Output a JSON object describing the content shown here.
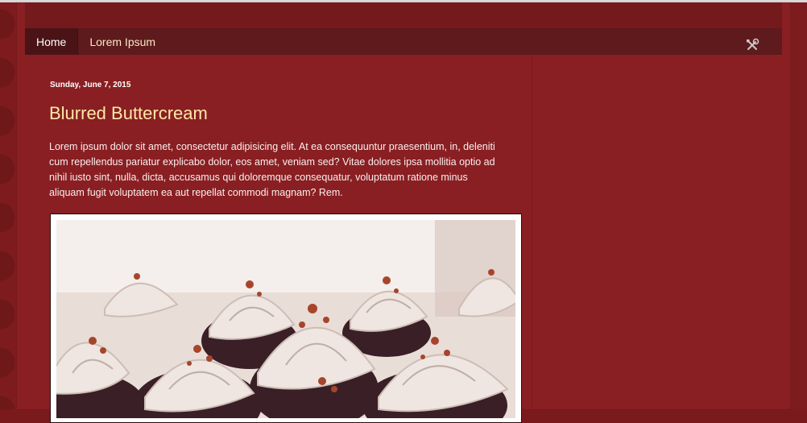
{
  "nav": {
    "tabs": [
      {
        "label": "Home"
      },
      {
        "label": "Lorem Ipsum"
      }
    ],
    "tools_icon": "tools-icon"
  },
  "post": {
    "date": "Sunday, June 7, 2015",
    "title": "Blurred Buttercream",
    "body": "Lorem ipsum dolor sit amet, consectetur adipisicing elit. At ea consequuntur praesentium, in, deleniti cum repellendus pariatur explicabo dolor, eos amet, veniam sed? Vitae dolores ipsa mollitia optio ad nihil iusto sint, nulla, dicta, accusamus qui doloremque consequatur, voluptatum ratione minus aliquam fugit voluptatem ea aut repellat commodi magnam? Rem.",
    "image_subject": "cupcakes with buttercream frosting"
  },
  "colors": {
    "background": "#7e1b1e",
    "nav_bar": "#5e1a1c",
    "title": "#fce9a8",
    "text": "#fbeeee"
  }
}
